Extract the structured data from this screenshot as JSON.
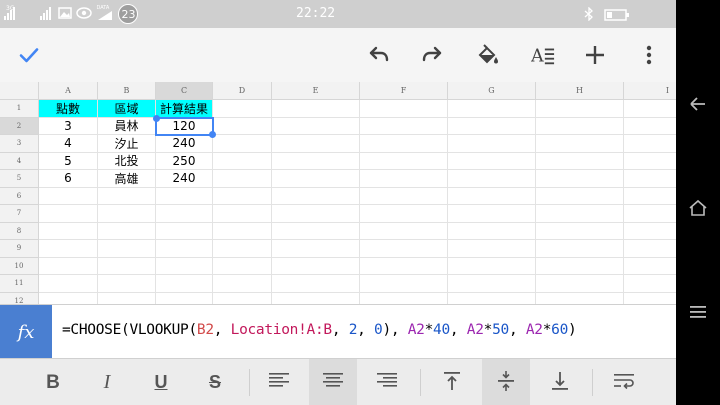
{
  "status": {
    "network_label": "3G",
    "data_label": "DATA",
    "badge_count": "23",
    "time": "22:22"
  },
  "toolbar": {
    "icons": [
      "check-icon",
      "undo-icon",
      "redo-icon",
      "fill-color-icon",
      "text-format-icon",
      "add-icon",
      "more-vert-icon"
    ]
  },
  "sheet": {
    "columns": [
      "A",
      "B",
      "C",
      "D",
      "E",
      "F",
      "G",
      "H",
      "I"
    ],
    "rows": [
      "1",
      "2",
      "3",
      "4",
      "5",
      "6",
      "7",
      "8",
      "9",
      "10",
      "11",
      "12"
    ],
    "header_row": [
      "點數",
      "區域",
      "計算結果"
    ],
    "data_rows": [
      [
        "3",
        "員林",
        "120"
      ],
      [
        "4",
        "汐止",
        "240"
      ],
      [
        "5",
        "北投",
        "250"
      ],
      [
        "6",
        "高雄",
        "240"
      ]
    ],
    "selected_cell": "C2",
    "header_fill": "#00ffff",
    "selection_color": "#4285f4"
  },
  "formula_bar": {
    "fx_label": "fx",
    "tokens": [
      {
        "t": "=CHOOSE(VLOOKUP(",
        "c": "#000000"
      },
      {
        "t": "B2",
        "c": "#d24a4a"
      },
      {
        "t": ", ",
        "c": "#000000"
      },
      {
        "t": "Location!A:B",
        "c": "#c2185b"
      },
      {
        "t": ", ",
        "c": "#000000"
      },
      {
        "t": "2",
        "c": "#1a56c8"
      },
      {
        "t": ", ",
        "c": "#000000"
      },
      {
        "t": "0",
        "c": "#1a56c8"
      },
      {
        "t": "), ",
        "c": "#000000"
      },
      {
        "t": "A2",
        "c": "#9c27b0"
      },
      {
        "t": "*",
        "c": "#000000"
      },
      {
        "t": "40",
        "c": "#1a56c8"
      },
      {
        "t": ", ",
        "c": "#000000"
      },
      {
        "t": "A2",
        "c": "#9c27b0"
      },
      {
        "t": "*",
        "c": "#000000"
      },
      {
        "t": "50",
        "c": "#1a56c8"
      },
      {
        "t": ", ",
        "c": "#000000"
      },
      {
        "t": "A2",
        "c": "#9c27b0"
      },
      {
        "t": "*",
        "c": "#000000"
      },
      {
        "t": "60",
        "c": "#1a56c8"
      },
      {
        "t": ")",
        "c": "#000000"
      }
    ]
  },
  "format_bar": {
    "bold_label": "B",
    "italic_label": "I",
    "underline_label": "U",
    "strike_label": "S",
    "icons": [
      "align-left-icon",
      "align-center-icon",
      "align-right-icon",
      "valign-top-icon",
      "valign-middle-icon",
      "valign-bottom-icon",
      "wrap-text-icon"
    ]
  }
}
